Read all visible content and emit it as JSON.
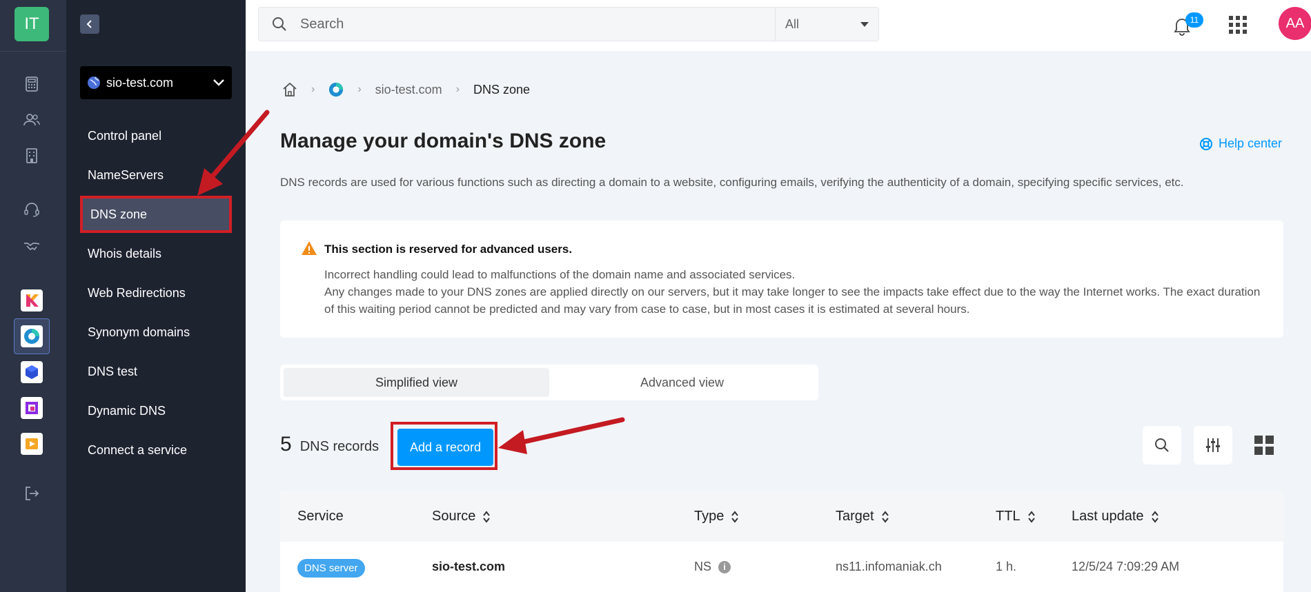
{
  "rail": {
    "logo_text": "IT",
    "icons": [
      "calculator-icon",
      "users-icon",
      "building-icon",
      "headset-icon",
      "handshake-icon"
    ],
    "apps": [
      "kmail-app-icon",
      "domains-app-icon",
      "cube-app-icon",
      "kchat-app-icon",
      "kdrive-app-icon"
    ],
    "logout_icon": "logout-icon"
  },
  "sidebar": {
    "domain": "sio-test.com",
    "items": [
      {
        "label": "Control panel"
      },
      {
        "label": "NameServers"
      },
      {
        "label": "DNS zone",
        "active": true
      },
      {
        "label": "Whois details"
      },
      {
        "label": "Web Redirections"
      },
      {
        "label": "Synonym domains"
      },
      {
        "label": "DNS test"
      },
      {
        "label": "Dynamic DNS"
      },
      {
        "label": "Connect a service"
      }
    ]
  },
  "topbar": {
    "search_placeholder": "Search",
    "search_scope": "All",
    "notification_count": "11",
    "avatar_initials": "AA"
  },
  "breadcrumb": {
    "domain": "sio-test.com",
    "current": "DNS zone"
  },
  "page": {
    "title": "Manage your domain's DNS zone",
    "help_label": "Help center",
    "intro": "DNS records are used for various functions such as directing a domain to a website, configuring emails, verifying the authenticity of a domain, specifying specific services, etc."
  },
  "warning": {
    "title": "This section is reserved for advanced users.",
    "line1": "Incorrect handling could lead to malfunctions of the domain name and associated services.",
    "line2": "Any changes made to your DNS zones are applied directly on our servers, but it may take longer to see the impacts take effect due to the way the Internet works. The exact duration of this waiting period cannot be predicted and may vary from case to case, but in most cases it is estimated at several hours."
  },
  "views": {
    "simplified": "Simplified view",
    "advanced": "Advanced view"
  },
  "records": {
    "count": "5",
    "label": "DNS records",
    "add_label": "Add a record"
  },
  "table": {
    "headers": {
      "service": "Service",
      "source": "Source",
      "type": "Type",
      "target": "Target",
      "ttl": "TTL",
      "last_update": "Last update"
    },
    "rows": [
      {
        "service": "DNS server",
        "source": "sio-test.com",
        "type": "NS",
        "target": "ns11.infomaniak.ch",
        "ttl": "1 h.",
        "last_update": "12/5/24 7:09:29 AM"
      }
    ]
  },
  "colors": {
    "accent": "#0098ff",
    "annotation": "#d11f26",
    "sidebar_bg": "#1e2330",
    "rail_bg": "#2b3344"
  }
}
